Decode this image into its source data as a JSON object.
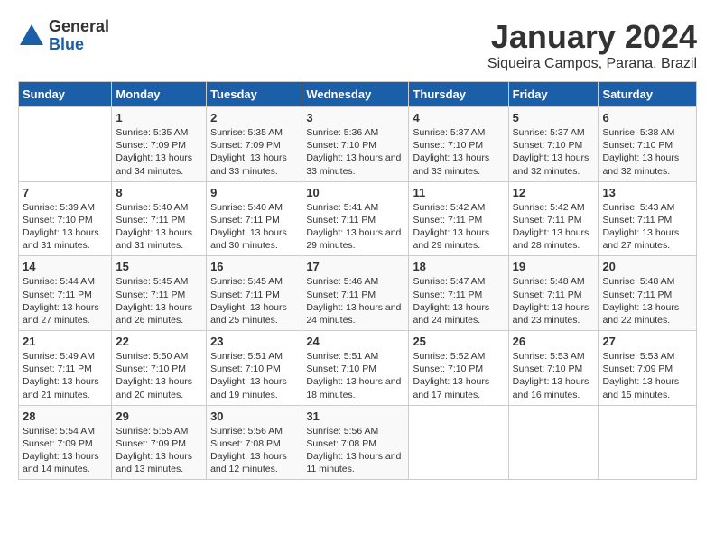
{
  "logo": {
    "general": "General",
    "blue": "Blue"
  },
  "title": "January 2024",
  "subtitle": "Siqueira Campos, Parana, Brazil",
  "days_of_week": [
    "Sunday",
    "Monday",
    "Tuesday",
    "Wednesday",
    "Thursday",
    "Friday",
    "Saturday"
  ],
  "weeks": [
    [
      {
        "day": "",
        "sunrise": "",
        "sunset": "",
        "daylight": ""
      },
      {
        "day": "1",
        "sunrise": "Sunrise: 5:35 AM",
        "sunset": "Sunset: 7:09 PM",
        "daylight": "Daylight: 13 hours and 34 minutes."
      },
      {
        "day": "2",
        "sunrise": "Sunrise: 5:35 AM",
        "sunset": "Sunset: 7:09 PM",
        "daylight": "Daylight: 13 hours and 33 minutes."
      },
      {
        "day": "3",
        "sunrise": "Sunrise: 5:36 AM",
        "sunset": "Sunset: 7:10 PM",
        "daylight": "Daylight: 13 hours and 33 minutes."
      },
      {
        "day": "4",
        "sunrise": "Sunrise: 5:37 AM",
        "sunset": "Sunset: 7:10 PM",
        "daylight": "Daylight: 13 hours and 33 minutes."
      },
      {
        "day": "5",
        "sunrise": "Sunrise: 5:37 AM",
        "sunset": "Sunset: 7:10 PM",
        "daylight": "Daylight: 13 hours and 32 minutes."
      },
      {
        "day": "6",
        "sunrise": "Sunrise: 5:38 AM",
        "sunset": "Sunset: 7:10 PM",
        "daylight": "Daylight: 13 hours and 32 minutes."
      }
    ],
    [
      {
        "day": "7",
        "sunrise": "Sunrise: 5:39 AM",
        "sunset": "Sunset: 7:10 PM",
        "daylight": "Daylight: 13 hours and 31 minutes."
      },
      {
        "day": "8",
        "sunrise": "Sunrise: 5:40 AM",
        "sunset": "Sunset: 7:11 PM",
        "daylight": "Daylight: 13 hours and 31 minutes."
      },
      {
        "day": "9",
        "sunrise": "Sunrise: 5:40 AM",
        "sunset": "Sunset: 7:11 PM",
        "daylight": "Daylight: 13 hours and 30 minutes."
      },
      {
        "day": "10",
        "sunrise": "Sunrise: 5:41 AM",
        "sunset": "Sunset: 7:11 PM",
        "daylight": "Daylight: 13 hours and 29 minutes."
      },
      {
        "day": "11",
        "sunrise": "Sunrise: 5:42 AM",
        "sunset": "Sunset: 7:11 PM",
        "daylight": "Daylight: 13 hours and 29 minutes."
      },
      {
        "day": "12",
        "sunrise": "Sunrise: 5:42 AM",
        "sunset": "Sunset: 7:11 PM",
        "daylight": "Daylight: 13 hours and 28 minutes."
      },
      {
        "day": "13",
        "sunrise": "Sunrise: 5:43 AM",
        "sunset": "Sunset: 7:11 PM",
        "daylight": "Daylight: 13 hours and 27 minutes."
      }
    ],
    [
      {
        "day": "14",
        "sunrise": "Sunrise: 5:44 AM",
        "sunset": "Sunset: 7:11 PM",
        "daylight": "Daylight: 13 hours and 27 minutes."
      },
      {
        "day": "15",
        "sunrise": "Sunrise: 5:45 AM",
        "sunset": "Sunset: 7:11 PM",
        "daylight": "Daylight: 13 hours and 26 minutes."
      },
      {
        "day": "16",
        "sunrise": "Sunrise: 5:45 AM",
        "sunset": "Sunset: 7:11 PM",
        "daylight": "Daylight: 13 hours and 25 minutes."
      },
      {
        "day": "17",
        "sunrise": "Sunrise: 5:46 AM",
        "sunset": "Sunset: 7:11 PM",
        "daylight": "Daylight: 13 hours and 24 minutes."
      },
      {
        "day": "18",
        "sunrise": "Sunrise: 5:47 AM",
        "sunset": "Sunset: 7:11 PM",
        "daylight": "Daylight: 13 hours and 24 minutes."
      },
      {
        "day": "19",
        "sunrise": "Sunrise: 5:48 AM",
        "sunset": "Sunset: 7:11 PM",
        "daylight": "Daylight: 13 hours and 23 minutes."
      },
      {
        "day": "20",
        "sunrise": "Sunrise: 5:48 AM",
        "sunset": "Sunset: 7:11 PM",
        "daylight": "Daylight: 13 hours and 22 minutes."
      }
    ],
    [
      {
        "day": "21",
        "sunrise": "Sunrise: 5:49 AM",
        "sunset": "Sunset: 7:11 PM",
        "daylight": "Daylight: 13 hours and 21 minutes."
      },
      {
        "day": "22",
        "sunrise": "Sunrise: 5:50 AM",
        "sunset": "Sunset: 7:10 PM",
        "daylight": "Daylight: 13 hours and 20 minutes."
      },
      {
        "day": "23",
        "sunrise": "Sunrise: 5:51 AM",
        "sunset": "Sunset: 7:10 PM",
        "daylight": "Daylight: 13 hours and 19 minutes."
      },
      {
        "day": "24",
        "sunrise": "Sunrise: 5:51 AM",
        "sunset": "Sunset: 7:10 PM",
        "daylight": "Daylight: 13 hours and 18 minutes."
      },
      {
        "day": "25",
        "sunrise": "Sunrise: 5:52 AM",
        "sunset": "Sunset: 7:10 PM",
        "daylight": "Daylight: 13 hours and 17 minutes."
      },
      {
        "day": "26",
        "sunrise": "Sunrise: 5:53 AM",
        "sunset": "Sunset: 7:10 PM",
        "daylight": "Daylight: 13 hours and 16 minutes."
      },
      {
        "day": "27",
        "sunrise": "Sunrise: 5:53 AM",
        "sunset": "Sunset: 7:09 PM",
        "daylight": "Daylight: 13 hours and 15 minutes."
      }
    ],
    [
      {
        "day": "28",
        "sunrise": "Sunrise: 5:54 AM",
        "sunset": "Sunset: 7:09 PM",
        "daylight": "Daylight: 13 hours and 14 minutes."
      },
      {
        "day": "29",
        "sunrise": "Sunrise: 5:55 AM",
        "sunset": "Sunset: 7:09 PM",
        "daylight": "Daylight: 13 hours and 13 minutes."
      },
      {
        "day": "30",
        "sunrise": "Sunrise: 5:56 AM",
        "sunset": "Sunset: 7:08 PM",
        "daylight": "Daylight: 13 hours and 12 minutes."
      },
      {
        "day": "31",
        "sunrise": "Sunrise: 5:56 AM",
        "sunset": "Sunset: 7:08 PM",
        "daylight": "Daylight: 13 hours and 11 minutes."
      },
      {
        "day": "",
        "sunrise": "",
        "sunset": "",
        "daylight": ""
      },
      {
        "day": "",
        "sunrise": "",
        "sunset": "",
        "daylight": ""
      },
      {
        "day": "",
        "sunrise": "",
        "sunset": "",
        "daylight": ""
      }
    ]
  ]
}
